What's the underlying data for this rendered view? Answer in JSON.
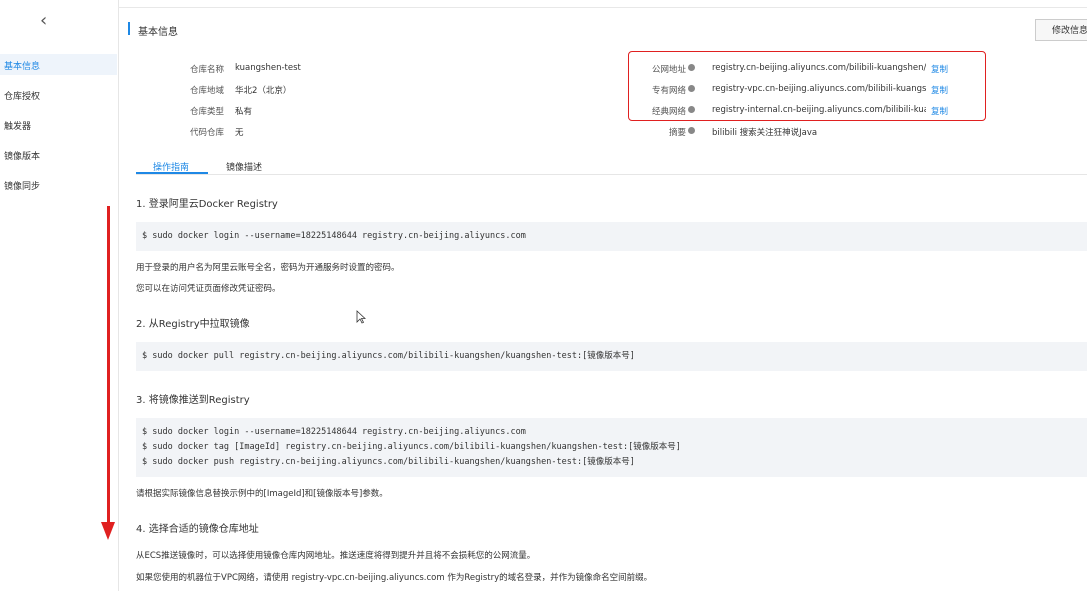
{
  "sidebar": {
    "back_icon": "chevron-left-icon",
    "items": [
      {
        "label": "基本信息",
        "active": true
      },
      {
        "label": "仓库授权",
        "active": false
      },
      {
        "label": "触发器",
        "active": false
      },
      {
        "label": "镜像版本",
        "active": false
      },
      {
        "label": "镜像同步",
        "active": false
      }
    ]
  },
  "header": {
    "title": "基本信息",
    "edit_button": "修改信息"
  },
  "repo_info": {
    "name_label": "仓库名称",
    "name_value": "kuangshen-test",
    "region_label": "仓库地域",
    "region_value": "华北2（北京）",
    "type_label": "仓库类型",
    "type_value": "私有",
    "code_label": "代码仓库",
    "code_value": "无"
  },
  "addresses": {
    "public_label": "公网地址",
    "public_value": "registry.cn-beijing.aliyuncs.com/bilibili-kuangshen/kuai",
    "vpc_label": "专有网络",
    "vpc_value": "registry-vpc.cn-beijing.aliyuncs.com/bilibili-kuangshen",
    "classic_label": "经典网络",
    "classic_value": "registry-internal.cn-beijing.aliyuncs.com/bilibili-kuangs",
    "copy_label": "复制",
    "summary_label": "摘要",
    "summary_value": "bilibili 搜索关注狂神说Java"
  },
  "tabs": [
    {
      "label": "操作指南",
      "active": true
    },
    {
      "label": "镜像描述",
      "active": false
    }
  ],
  "guide": {
    "step1_title": "1. 登录阿里云Docker Registry",
    "step1_code": "$ sudo docker login --username=18225148644 registry.cn-beijing.aliyuncs.com",
    "step1_note1": "用于登录的用户名为阿里云账号全名，密码为开通服务时设置的密码。",
    "step1_note2": "您可以在访问凭证页面修改凭证密码。",
    "step2_title": "2. 从Registry中拉取镜像",
    "step2_code": "$ sudo docker pull registry.cn-beijing.aliyuncs.com/bilibili-kuangshen/kuangshen-test:[镜像版本号]",
    "step3_title": "3. 将镜像推送到Registry",
    "step3_code1": "$ sudo docker login --username=18225148644 registry.cn-beijing.aliyuncs.com",
    "step3_code2": "$ sudo docker tag [ImageId] registry.cn-beijing.aliyuncs.com/bilibili-kuangshen/kuangshen-test:[镜像版本号]",
    "step3_code3": "$ sudo docker push registry.cn-beijing.aliyuncs.com/bilibili-kuangshen/kuangshen-test:[镜像版本号]",
    "step3_note": "请根据实际镜像信息替换示例中的[ImageId]和[镜像版本号]参数。",
    "step4_title": "4. 选择合适的镜像仓库地址",
    "step4_note1": "从ECS推送镜像时，可以选择使用镜像仓库内网地址。推送速度将得到提升并且将不会损耗您的公网流量。",
    "step4_note2": "如果您使用的机器位于VPC网络，请使用 registry-vpc.cn-beijing.aliyuncs.com 作为Registry的域名登录，并作为镜像命名空间前缀。"
  },
  "colors": {
    "accent": "#1e88e5",
    "annotation": "#e02020"
  }
}
